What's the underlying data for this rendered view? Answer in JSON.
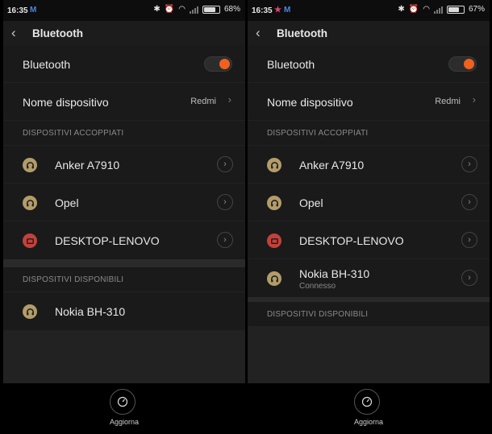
{
  "panels": [
    {
      "status": {
        "time": "16:35",
        "notif_m": "M",
        "notif_star": "",
        "battery": "68%",
        "battery_level": 0.68
      },
      "header": {
        "title": "Bluetooth"
      },
      "bluetooth_row": {
        "label": "Bluetooth",
        "enabled": true
      },
      "device_name_row": {
        "label": "Nome dispositivo",
        "value": "Redmi"
      },
      "paired_header": "DISPOSITIVI ACCOPPIATI",
      "paired": [
        {
          "name": "Anker A7910",
          "icon": "headphones-icon",
          "status": ""
        },
        {
          "name": "Opel",
          "icon": "headphones-icon",
          "status": ""
        },
        {
          "name": "DESKTOP-LENOVO",
          "icon": "computer-icon",
          "status": ""
        }
      ],
      "available_header": "DISPOSITIVI DISPONIBILI",
      "available": [
        {
          "name": "Nokia BH-310",
          "icon": "headphones-icon"
        }
      ],
      "refresh_label": "Aggiorna"
    },
    {
      "status": {
        "time": "16:35",
        "notif_m": "M",
        "notif_star": "★",
        "battery": "67%",
        "battery_level": 0.67
      },
      "header": {
        "title": "Bluetooth"
      },
      "bluetooth_row": {
        "label": "Bluetooth",
        "enabled": true
      },
      "device_name_row": {
        "label": "Nome dispositivo",
        "value": "Redmi"
      },
      "paired_header": "DISPOSITIVI ACCOPPIATI",
      "paired": [
        {
          "name": "Anker A7910",
          "icon": "headphones-icon",
          "status": ""
        },
        {
          "name": "Opel",
          "icon": "headphones-icon",
          "status": ""
        },
        {
          "name": "DESKTOP-LENOVO",
          "icon": "computer-icon",
          "status": ""
        },
        {
          "name": "Nokia BH-310",
          "icon": "headphones-icon",
          "status": "Connesso"
        }
      ],
      "available_header": "DISPOSITIVI DISPONIBILI",
      "available": [],
      "refresh_label": "Aggiorna"
    }
  ],
  "colors": {
    "accent": "#f0601f",
    "headphone_icon_bg": "#b39c6a",
    "computer_icon_bg": "#c2413b",
    "gmail_m": "#4a86e8",
    "star": "#e0457b"
  }
}
